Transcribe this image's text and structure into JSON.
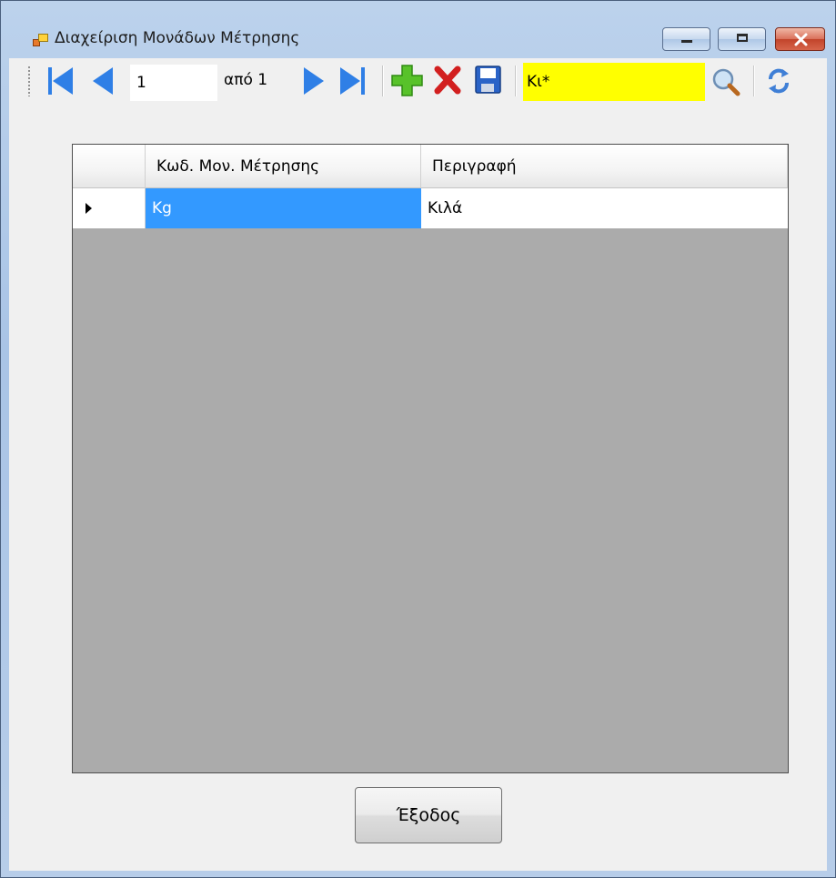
{
  "window": {
    "title": "Διαχείριση Μονάδων Μέτρησης",
    "controls": {
      "minimize": "minimize-icon",
      "maximize": "maximize-icon",
      "close": "close-icon"
    }
  },
  "toolbar": {
    "position": "1",
    "of_label": "από 1",
    "search_value": "Κι*",
    "icons": [
      "move-first-icon",
      "move-previous-icon",
      "move-next-icon",
      "move-last-icon",
      "add-icon",
      "delete-icon",
      "save-icon",
      "search-icon",
      "refresh-icon"
    ],
    "colors": {
      "nav": "#2f7fe6",
      "search_bg": "#ffff00"
    }
  },
  "grid": {
    "columns": [
      "Κωδ. Μον. Μέτρησης",
      "Περιγραφή"
    ],
    "rows": [
      {
        "code": "Kg",
        "description": "Κιλά"
      }
    ],
    "selection_color": "#3399ff"
  },
  "exit_button": {
    "label": "Έξοδος"
  }
}
